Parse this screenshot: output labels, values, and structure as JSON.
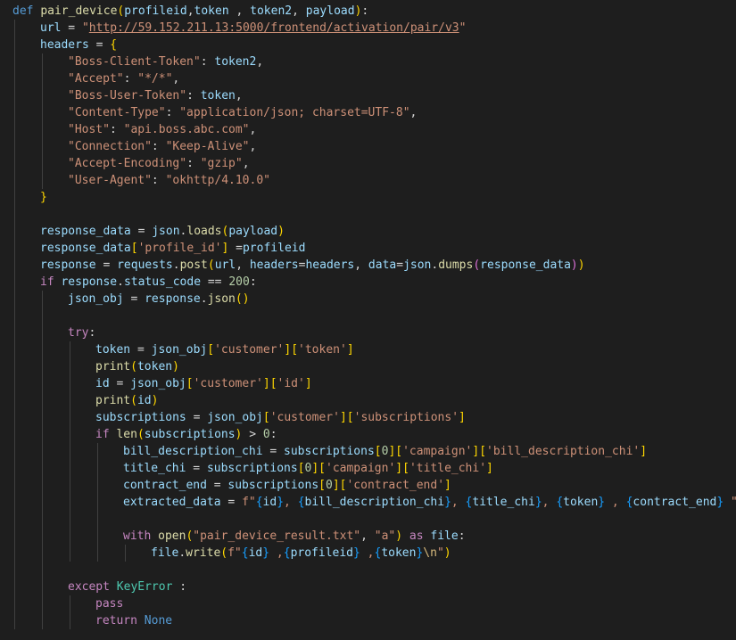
{
  "code_lines": [
    {
      "indent": 0,
      "tokens": [
        [
          "def",
          "kw"
        ],
        [
          " ",
          "plain"
        ],
        [
          "pair_device",
          "fn"
        ],
        [
          "(",
          "brk1"
        ],
        [
          "profileid",
          "param"
        ],
        [
          ",",
          "plain"
        ],
        [
          "token",
          "param"
        ],
        [
          " , ",
          "plain"
        ],
        [
          "token2",
          "param"
        ],
        [
          ", ",
          "plain"
        ],
        [
          "payload",
          "param"
        ],
        [
          ")",
          "brk1"
        ],
        [
          ":",
          "plain"
        ]
      ]
    },
    {
      "indent": 1,
      "tokens": [
        [
          "url",
          "var"
        ],
        [
          " = ",
          "op"
        ],
        [
          "\"",
          "str"
        ],
        [
          "http://59.152.211.13:5000/frontend/activation/pair/v3",
          "url"
        ],
        [
          "\"",
          "str"
        ]
      ]
    },
    {
      "indent": 1,
      "tokens": [
        [
          "headers",
          "var"
        ],
        [
          " = ",
          "op"
        ],
        [
          "{",
          "brk1"
        ]
      ]
    },
    {
      "indent": 2,
      "tokens": [
        [
          "\"Boss-Client-Token\"",
          "str"
        ],
        [
          ": ",
          "plain"
        ],
        [
          "token2",
          "var"
        ],
        [
          ",",
          "plain"
        ]
      ]
    },
    {
      "indent": 2,
      "tokens": [
        [
          "\"Accept\"",
          "str"
        ],
        [
          ": ",
          "plain"
        ],
        [
          "\"*/*\"",
          "str"
        ],
        [
          ",",
          "plain"
        ]
      ]
    },
    {
      "indent": 2,
      "tokens": [
        [
          "\"Boss-User-Token\"",
          "str"
        ],
        [
          ": ",
          "plain"
        ],
        [
          "token",
          "var"
        ],
        [
          ",",
          "plain"
        ]
      ]
    },
    {
      "indent": 2,
      "tokens": [
        [
          "\"Content-Type\"",
          "str"
        ],
        [
          ": ",
          "plain"
        ],
        [
          "\"application/json; charset=UTF-8\"",
          "str"
        ],
        [
          ",",
          "plain"
        ]
      ]
    },
    {
      "indent": 2,
      "tokens": [
        [
          "\"Host\"",
          "str"
        ],
        [
          ": ",
          "plain"
        ],
        [
          "\"api.boss.abc.com\"",
          "str"
        ],
        [
          ",",
          "plain"
        ]
      ]
    },
    {
      "indent": 2,
      "tokens": [
        [
          "\"Connection\"",
          "str"
        ],
        [
          ": ",
          "plain"
        ],
        [
          "\"Keep-Alive\"",
          "str"
        ],
        [
          ",",
          "plain"
        ]
      ]
    },
    {
      "indent": 2,
      "tokens": [
        [
          "\"Accept-Encoding\"",
          "str"
        ],
        [
          ": ",
          "plain"
        ],
        [
          "\"gzip\"",
          "str"
        ],
        [
          ",",
          "plain"
        ]
      ]
    },
    {
      "indent": 2,
      "tokens": [
        [
          "\"User-Agent\"",
          "str"
        ],
        [
          ": ",
          "plain"
        ],
        [
          "\"okhttp/4.10.0\"",
          "str"
        ]
      ]
    },
    {
      "indent": 1,
      "tokens": [
        [
          "}",
          "brk1"
        ]
      ]
    },
    {
      "indent": 0,
      "tokens": []
    },
    {
      "indent": 1,
      "tokens": [
        [
          "response_data",
          "var"
        ],
        [
          " = ",
          "op"
        ],
        [
          "json",
          "var"
        ],
        [
          ".",
          "plain"
        ],
        [
          "loads",
          "fn"
        ],
        [
          "(",
          "brk1"
        ],
        [
          "payload",
          "var"
        ],
        [
          ")",
          "brk1"
        ]
      ]
    },
    {
      "indent": 1,
      "tokens": [
        [
          "response_data",
          "var"
        ],
        [
          "[",
          "brk1"
        ],
        [
          "'profile_id'",
          "str"
        ],
        [
          "]",
          "brk1"
        ],
        [
          " =",
          "op"
        ],
        [
          "profileid",
          "var"
        ]
      ]
    },
    {
      "indent": 1,
      "tokens": [
        [
          "response",
          "var"
        ],
        [
          " = ",
          "op"
        ],
        [
          "requests",
          "var"
        ],
        [
          ".",
          "plain"
        ],
        [
          "post",
          "fn"
        ],
        [
          "(",
          "brk1"
        ],
        [
          "url",
          "var"
        ],
        [
          ", ",
          "plain"
        ],
        [
          "headers",
          "var"
        ],
        [
          "=",
          "op"
        ],
        [
          "headers",
          "var"
        ],
        [
          ", ",
          "plain"
        ],
        [
          "data",
          "var"
        ],
        [
          "=",
          "op"
        ],
        [
          "json",
          "var"
        ],
        [
          ".",
          "plain"
        ],
        [
          "dumps",
          "fn"
        ],
        [
          "(",
          "brk2"
        ],
        [
          "response_data",
          "var"
        ],
        [
          ")",
          "brk2"
        ],
        [
          ")",
          "brk1"
        ]
      ]
    },
    {
      "indent": 1,
      "tokens": [
        [
          "if",
          "ctrl"
        ],
        [
          " ",
          "plain"
        ],
        [
          "response",
          "var"
        ],
        [
          ".",
          "plain"
        ],
        [
          "status_code",
          "var"
        ],
        [
          " == ",
          "op"
        ],
        [
          "200",
          "num"
        ],
        [
          ":",
          "plain"
        ]
      ]
    },
    {
      "indent": 2,
      "tokens": [
        [
          "json_obj",
          "var"
        ],
        [
          " = ",
          "op"
        ],
        [
          "response",
          "var"
        ],
        [
          ".",
          "plain"
        ],
        [
          "json",
          "fn"
        ],
        [
          "(",
          "brk1"
        ],
        [
          ")",
          "brk1"
        ]
      ]
    },
    {
      "indent": 0,
      "tokens": []
    },
    {
      "indent": 2,
      "tokens": [
        [
          "try",
          "ctrl"
        ],
        [
          ":",
          "plain"
        ]
      ]
    },
    {
      "indent": 3,
      "tokens": [
        [
          "token",
          "var"
        ],
        [
          " = ",
          "op"
        ],
        [
          "json_obj",
          "var"
        ],
        [
          "[",
          "brk1"
        ],
        [
          "'customer'",
          "str"
        ],
        [
          "]",
          "brk1"
        ],
        [
          "[",
          "brk1"
        ],
        [
          "'token'",
          "str"
        ],
        [
          "]",
          "brk1"
        ]
      ]
    },
    {
      "indent": 3,
      "tokens": [
        [
          "print",
          "fn"
        ],
        [
          "(",
          "brk1"
        ],
        [
          "token",
          "var"
        ],
        [
          ")",
          "brk1"
        ]
      ]
    },
    {
      "indent": 3,
      "tokens": [
        [
          "id",
          "var"
        ],
        [
          " = ",
          "op"
        ],
        [
          "json_obj",
          "var"
        ],
        [
          "[",
          "brk1"
        ],
        [
          "'customer'",
          "str"
        ],
        [
          "]",
          "brk1"
        ],
        [
          "[",
          "brk1"
        ],
        [
          "'id'",
          "str"
        ],
        [
          "]",
          "brk1"
        ]
      ]
    },
    {
      "indent": 3,
      "tokens": [
        [
          "print",
          "fn"
        ],
        [
          "(",
          "brk1"
        ],
        [
          "id",
          "var"
        ],
        [
          ")",
          "brk1"
        ]
      ]
    },
    {
      "indent": 3,
      "tokens": [
        [
          "subscriptions",
          "var"
        ],
        [
          " = ",
          "op"
        ],
        [
          "json_obj",
          "var"
        ],
        [
          "[",
          "brk1"
        ],
        [
          "'customer'",
          "str"
        ],
        [
          "]",
          "brk1"
        ],
        [
          "[",
          "brk1"
        ],
        [
          "'subscriptions'",
          "str"
        ],
        [
          "]",
          "brk1"
        ]
      ]
    },
    {
      "indent": 3,
      "tokens": [
        [
          "if",
          "ctrl"
        ],
        [
          " ",
          "plain"
        ],
        [
          "len",
          "fn"
        ],
        [
          "(",
          "brk1"
        ],
        [
          "subscriptions",
          "var"
        ],
        [
          ")",
          "brk1"
        ],
        [
          " > ",
          "op"
        ],
        [
          "0",
          "num"
        ],
        [
          ":",
          "plain"
        ]
      ]
    },
    {
      "indent": 4,
      "tokens": [
        [
          "bill_description_chi",
          "var"
        ],
        [
          " = ",
          "op"
        ],
        [
          "subscriptions",
          "var"
        ],
        [
          "[",
          "brk1"
        ],
        [
          "0",
          "num"
        ],
        [
          "]",
          "brk1"
        ],
        [
          "[",
          "brk1"
        ],
        [
          "'campaign'",
          "str"
        ],
        [
          "]",
          "brk1"
        ],
        [
          "[",
          "brk1"
        ],
        [
          "'bill_description_chi'",
          "str"
        ],
        [
          "]",
          "brk1"
        ]
      ]
    },
    {
      "indent": 4,
      "tokens": [
        [
          "title_chi",
          "var"
        ],
        [
          " = ",
          "op"
        ],
        [
          "subscriptions",
          "var"
        ],
        [
          "[",
          "brk1"
        ],
        [
          "0",
          "num"
        ],
        [
          "]",
          "brk1"
        ],
        [
          "[",
          "brk1"
        ],
        [
          "'campaign'",
          "str"
        ],
        [
          "]",
          "brk1"
        ],
        [
          "[",
          "brk1"
        ],
        [
          "'title_chi'",
          "str"
        ],
        [
          "]",
          "brk1"
        ]
      ]
    },
    {
      "indent": 4,
      "tokens": [
        [
          "contract_end",
          "var"
        ],
        [
          " = ",
          "op"
        ],
        [
          "subscriptions",
          "var"
        ],
        [
          "[",
          "brk1"
        ],
        [
          "0",
          "num"
        ],
        [
          "]",
          "brk1"
        ],
        [
          "[",
          "brk1"
        ],
        [
          "'contract_end'",
          "str"
        ],
        [
          "]",
          "brk1"
        ]
      ]
    },
    {
      "indent": 4,
      "tokens": [
        [
          "extracted_data",
          "var"
        ],
        [
          " = ",
          "op"
        ],
        [
          "f\"",
          "str"
        ],
        [
          "{",
          "brk3"
        ],
        [
          "id",
          "var"
        ],
        [
          "}",
          "brk3"
        ],
        [
          ", ",
          "str"
        ],
        [
          "{",
          "brk3"
        ],
        [
          "bill_description_chi",
          "var"
        ],
        [
          "}",
          "brk3"
        ],
        [
          ", ",
          "str"
        ],
        [
          "{",
          "brk3"
        ],
        [
          "title_chi",
          "var"
        ],
        [
          "}",
          "brk3"
        ],
        [
          ", ",
          "str"
        ],
        [
          "{",
          "brk3"
        ],
        [
          "token",
          "var"
        ],
        [
          "}",
          "brk3"
        ],
        [
          " , ",
          "str"
        ],
        [
          "{",
          "brk3"
        ],
        [
          "contract_end",
          "var"
        ],
        [
          "}",
          "brk3"
        ],
        [
          " \"",
          "str"
        ]
      ]
    },
    {
      "indent": 0,
      "tokens": []
    },
    {
      "indent": 4,
      "tokens": [
        [
          "with",
          "ctrl"
        ],
        [
          " ",
          "plain"
        ],
        [
          "open",
          "fn"
        ],
        [
          "(",
          "brk1"
        ],
        [
          "\"pair_device_result.txt\"",
          "str"
        ],
        [
          ", ",
          "plain"
        ],
        [
          "\"a\"",
          "str"
        ],
        [
          ")",
          "brk1"
        ],
        [
          " ",
          "plain"
        ],
        [
          "as",
          "ctrl"
        ],
        [
          " ",
          "plain"
        ],
        [
          "file",
          "var"
        ],
        [
          ":",
          "plain"
        ]
      ]
    },
    {
      "indent": 5,
      "tokens": [
        [
          "file",
          "var"
        ],
        [
          ".",
          "plain"
        ],
        [
          "write",
          "fn"
        ],
        [
          "(",
          "brk1"
        ],
        [
          "f\"",
          "str"
        ],
        [
          "{",
          "brk3"
        ],
        [
          "id",
          "var"
        ],
        [
          "}",
          "brk3"
        ],
        [
          " ,",
          "str"
        ],
        [
          "{",
          "brk3"
        ],
        [
          "profileid",
          "var"
        ],
        [
          "}",
          "brk3"
        ],
        [
          " ,",
          "str"
        ],
        [
          "{",
          "brk3"
        ],
        [
          "token",
          "var"
        ],
        [
          "}",
          "brk3"
        ],
        [
          "\\n",
          "esc"
        ],
        [
          "\"",
          "str"
        ],
        [
          ")",
          "brk1"
        ]
      ]
    },
    {
      "indent": 0,
      "tokens": []
    },
    {
      "indent": 2,
      "tokens": [
        [
          "except",
          "ctrl"
        ],
        [
          " ",
          "plain"
        ],
        [
          "KeyError",
          "cls"
        ],
        [
          " :",
          "plain"
        ]
      ]
    },
    {
      "indent": 3,
      "tokens": [
        [
          "pass",
          "ctrl"
        ]
      ]
    },
    {
      "indent": 3,
      "tokens": [
        [
          "return",
          "ctrl"
        ],
        [
          " ",
          "plain"
        ],
        [
          "None",
          "kw"
        ]
      ]
    }
  ]
}
